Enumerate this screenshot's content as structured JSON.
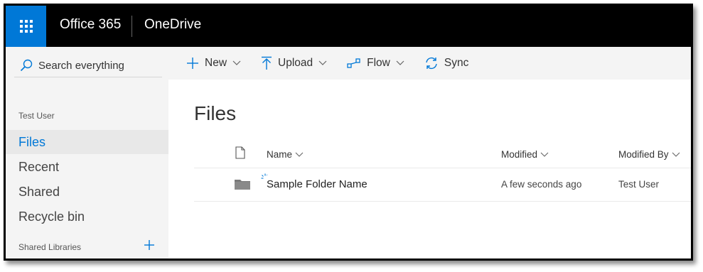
{
  "suite": {
    "brand": "Office 365",
    "app": "OneDrive",
    "colors": {
      "bar": "#000000",
      "waffle": "#0078d7"
    }
  },
  "leftnav": {
    "search_placeholder": "Search everything",
    "user": "Test User",
    "items": [
      {
        "label": "Files",
        "active": true
      },
      {
        "label": "Recent",
        "active": false
      },
      {
        "label": "Shared",
        "active": false
      },
      {
        "label": "Recycle bin",
        "active": false
      }
    ],
    "shared_libraries": "Shared Libraries"
  },
  "commandbar": {
    "new": "New",
    "upload": "Upload",
    "flow": "Flow",
    "sync": "Sync"
  },
  "main": {
    "title": "Files",
    "columns": {
      "name": "Name",
      "modified": "Modified",
      "modified_by": "Modified By"
    },
    "rows": [
      {
        "name": "Sample Folder Name",
        "modified": "A few seconds ago",
        "modified_by": "Test User",
        "type": "folder"
      }
    ]
  }
}
